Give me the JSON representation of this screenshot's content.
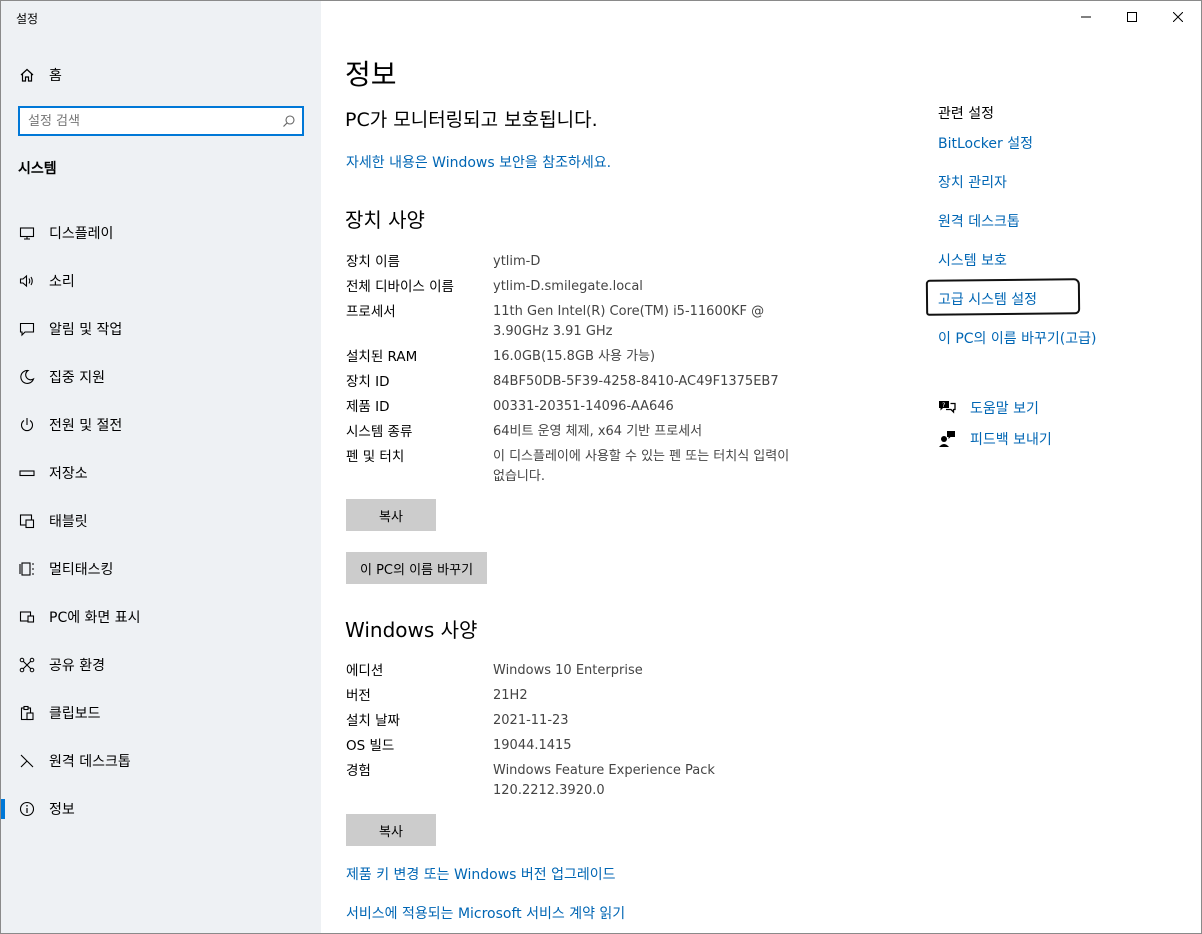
{
  "window": {
    "title": "설정"
  },
  "sidebar": {
    "home_label": "홈",
    "search_placeholder": "설정 검색",
    "section_title": "시스템",
    "items": [
      {
        "label": "디스플레이",
        "icon": "monitor-icon"
      },
      {
        "label": "소리",
        "icon": "speaker-icon"
      },
      {
        "label": "알림 및 작업",
        "icon": "notification-icon"
      },
      {
        "label": "집중 지원",
        "icon": "moon-icon"
      },
      {
        "label": "전원 및 절전",
        "icon": "power-icon"
      },
      {
        "label": "저장소",
        "icon": "storage-icon"
      },
      {
        "label": "태블릿",
        "icon": "tablet-icon"
      },
      {
        "label": "멀티태스킹",
        "icon": "multitasking-icon"
      },
      {
        "label": "PC에 화면 표시",
        "icon": "project-icon"
      },
      {
        "label": "공유 환경",
        "icon": "shared-icon"
      },
      {
        "label": "클립보드",
        "icon": "clipboard-icon"
      },
      {
        "label": "원격 데스크톱",
        "icon": "remote-desktop-icon"
      },
      {
        "label": "정보",
        "icon": "info-icon"
      }
    ]
  },
  "main": {
    "title": "정보",
    "status": "PC가 모니터링되고 보호됩니다.",
    "security_link": "자세한 내용은 Windows 보안을 참조하세요.",
    "device_specs": {
      "heading": "장치 사양",
      "rows": [
        {
          "key": "장치 이름",
          "value": "ytlim-D"
        },
        {
          "key": "전체 디바이스 이름",
          "value": "ytlim-D.smilegate.local"
        },
        {
          "key": "프로세서",
          "value": "11th Gen Intel(R) Core(TM) i5-11600KF @ 3.90GHz   3.91 GHz"
        },
        {
          "key": "설치된 RAM",
          "value": "16.0GB(15.8GB 사용 가능)"
        },
        {
          "key": "장치 ID",
          "value": "84BF50DB-5F39-4258-8410-AC49F1375EB7"
        },
        {
          "key": "제품 ID",
          "value": "00331-20351-14096-AA646"
        },
        {
          "key": "시스템 종류",
          "value": "64비트 운영 체제, x64 기반 프로세서"
        },
        {
          "key": "펜 및 터치",
          "value": "이 디스플레이에 사용할 수 있는 펜 또는 터치식 입력이 없습니다."
        }
      ],
      "copy_label": "복사",
      "rename_label": "이 PC의 이름 바꾸기"
    },
    "windows_specs": {
      "heading": "Windows 사양",
      "rows": [
        {
          "key": "에디션",
          "value": "Windows 10 Enterprise"
        },
        {
          "key": "버전",
          "value": "21H2"
        },
        {
          "key": "설치 날짜",
          "value": "2021-11-23"
        },
        {
          "key": "OS 빌드",
          "value": "19044.1415"
        },
        {
          "key": "경험",
          "value": "Windows Feature Experience Pack 120.2212.3920.0"
        }
      ],
      "copy_label": "복사"
    },
    "bottom_links": [
      "제품 키 변경 또는 Windows 버전 업그레이드",
      "서비스에 적용되는 Microsoft 서비스 계약 읽기"
    ]
  },
  "related": {
    "heading": "관련 설정",
    "links": [
      "BitLocker 설정",
      "장치 관리자",
      "원격 데스크톱",
      "시스템 보호",
      "고급 시스템 설정",
      "이 PC의 이름 바꾸기(고급)"
    ],
    "help_label": "도움말 보기",
    "feedback_label": "피드백 보내기"
  }
}
